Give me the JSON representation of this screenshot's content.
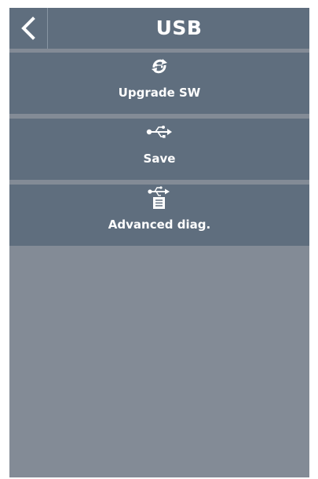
{
  "header": {
    "title": "USB"
  },
  "icons": {
    "back": "chevron-left-icon",
    "upgrade": "usb-upgrade-icon",
    "save": "usb-icon",
    "advanced": "usb-document-icon"
  },
  "menu": {
    "items": [
      {
        "label": "Upgrade SW"
      },
      {
        "label": "Save"
      },
      {
        "label": "Advanced diag."
      }
    ]
  },
  "colors": {
    "panel": "#5f6e7e",
    "background": "#838b96",
    "text": "#ffffff"
  }
}
